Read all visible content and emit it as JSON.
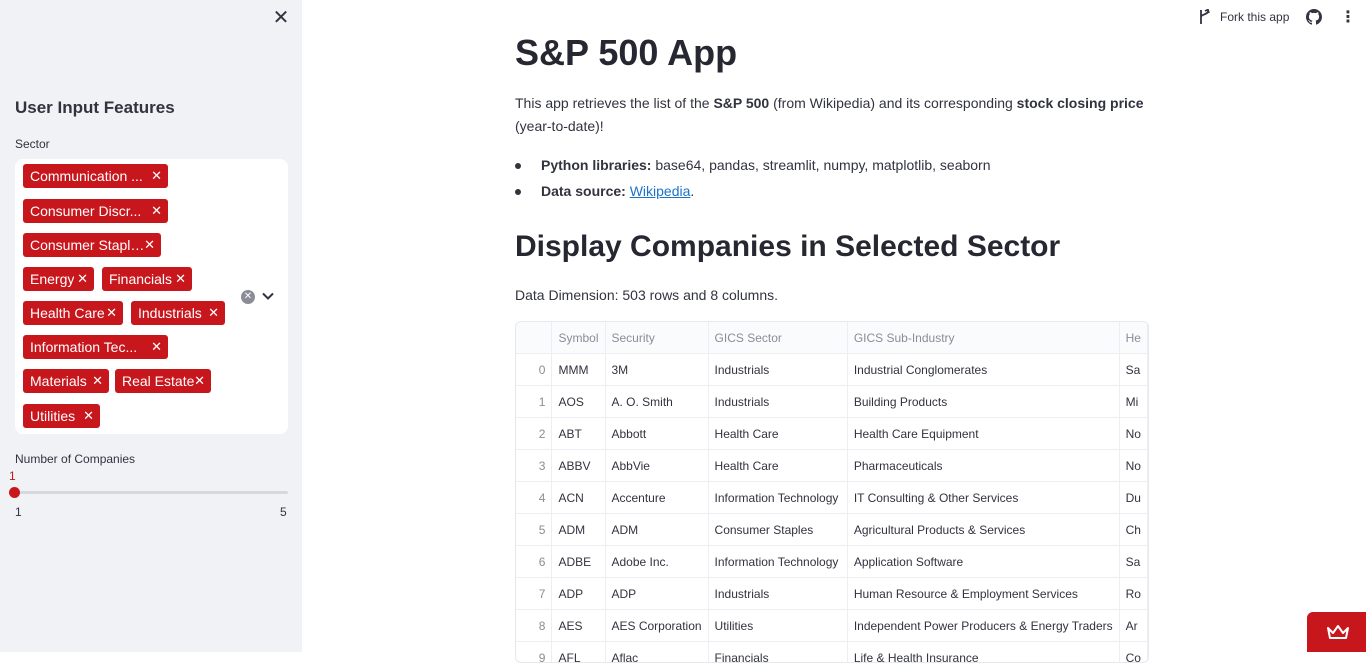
{
  "sidebar": {
    "title": "User Input Features",
    "sector_label": "Sector",
    "sector_tags": [
      "Communication Services",
      "Consumer Discretionary",
      "Consumer Staples",
      "Energy",
      "Financials",
      "Health Care",
      "Industrials",
      "Information Technology",
      "Materials",
      "Real Estate",
      "Utilities"
    ],
    "sector_tags_display": [
      "Communication ...",
      "Consumer Discr...",
      "Consumer Staples",
      "Energy",
      "Financials",
      "Health Care",
      "Industrials",
      "Information Tec...",
      "Materials",
      "Real Estate",
      "Utilities"
    ],
    "slider": {
      "label": "Number of Companies",
      "value": "1",
      "min": "1",
      "max": "5"
    }
  },
  "header": {
    "fork_label": "Fork this app"
  },
  "main": {
    "title": "S&P 500 App",
    "intro_prefix": "This app retrieves the list of the ",
    "intro_bold1": "S&P 500",
    "intro_mid": " (from Wikipedia) and its corresponding ",
    "intro_bold2": "stock closing price",
    "intro_suffix": " (year-to-date)!",
    "bullet1_label": "Python libraries:",
    "bullet1_text": " base64, pandas, streamlit, numpy, matplotlib, seaborn",
    "bullet2_label": "Data source:",
    "bullet2_link": "Wikipedia",
    "bullet2_end": ".",
    "section_title": "Display Companies in Selected Sector",
    "dimension_text": "Data Dimension: 503 rows and 8 columns.",
    "table": {
      "columns": [
        "",
        "Symbol",
        "Security",
        "GICS Sector",
        "GICS Sub-Industry",
        "He"
      ],
      "rows": [
        [
          "0",
          "MMM",
          "3M",
          "Industrials",
          "Industrial Conglomerates",
          "Sa"
        ],
        [
          "1",
          "AOS",
          "A. O. Smith",
          "Industrials",
          "Building Products",
          "Mi"
        ],
        [
          "2",
          "ABT",
          "Abbott",
          "Health Care",
          "Health Care Equipment",
          "No"
        ],
        [
          "3",
          "ABBV",
          "AbbVie",
          "Health Care",
          "Pharmaceuticals",
          "No"
        ],
        [
          "4",
          "ACN",
          "Accenture",
          "Information Technology",
          "IT Consulting & Other Services",
          "Du"
        ],
        [
          "5",
          "ADM",
          "ADM",
          "Consumer Staples",
          "Agricultural Products & Services",
          "Ch"
        ],
        [
          "6",
          "ADBE",
          "Adobe Inc.",
          "Information Technology",
          "Application Software",
          "Sa"
        ],
        [
          "7",
          "ADP",
          "ADP",
          "Industrials",
          "Human Resource & Employment Services",
          "Ro"
        ],
        [
          "8",
          "AES",
          "AES Corporation",
          "Utilities",
          "Independent Power Producers & Energy Traders",
          "Ar"
        ],
        [
          "9",
          "AFL",
          "Aflac",
          "Financials",
          "Life & Health Insurance",
          "Co"
        ]
      ]
    }
  },
  "colors": {
    "accent": "#c8161d",
    "sidebar_bg": "#f0f2f6",
    "text": "#31333f",
    "link": "#1a73c8"
  },
  "icons": [
    "close-icon",
    "clear-all-icon",
    "chevron-down-icon",
    "fork-icon",
    "github-icon",
    "more-vertical-icon",
    "crown-icon"
  ]
}
